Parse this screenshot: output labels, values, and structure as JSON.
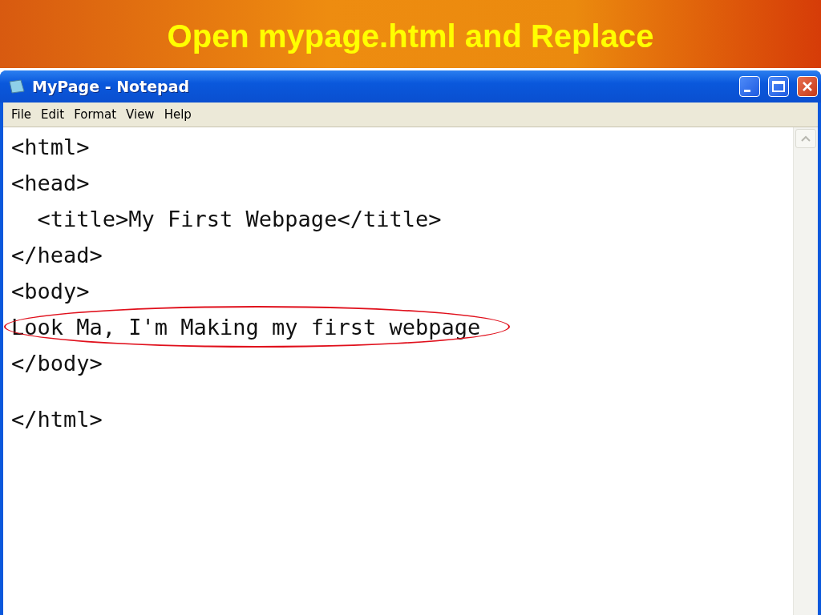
{
  "slide": {
    "title": "Open mypage.html and Replace"
  },
  "window": {
    "title": "MyPage - Notepad"
  },
  "menu": [
    "File",
    "Edit",
    "Format",
    "View",
    "Help"
  ],
  "lines": [
    {
      "text": "<html>",
      "circled": false
    },
    {
      "text": "<head>",
      "circled": false
    },
    {
      "text": "  <title>My First Webpage</title>",
      "circled": false
    },
    {
      "text": "</head>",
      "circled": false
    },
    {
      "text": "<body>",
      "circled": false
    },
    {
      "text": "Look Ma, I'm Making my first webpage",
      "circled": true
    },
    {
      "text": "</body>",
      "circled": false
    },
    {
      "text": "</html>",
      "circled": false
    }
  ]
}
